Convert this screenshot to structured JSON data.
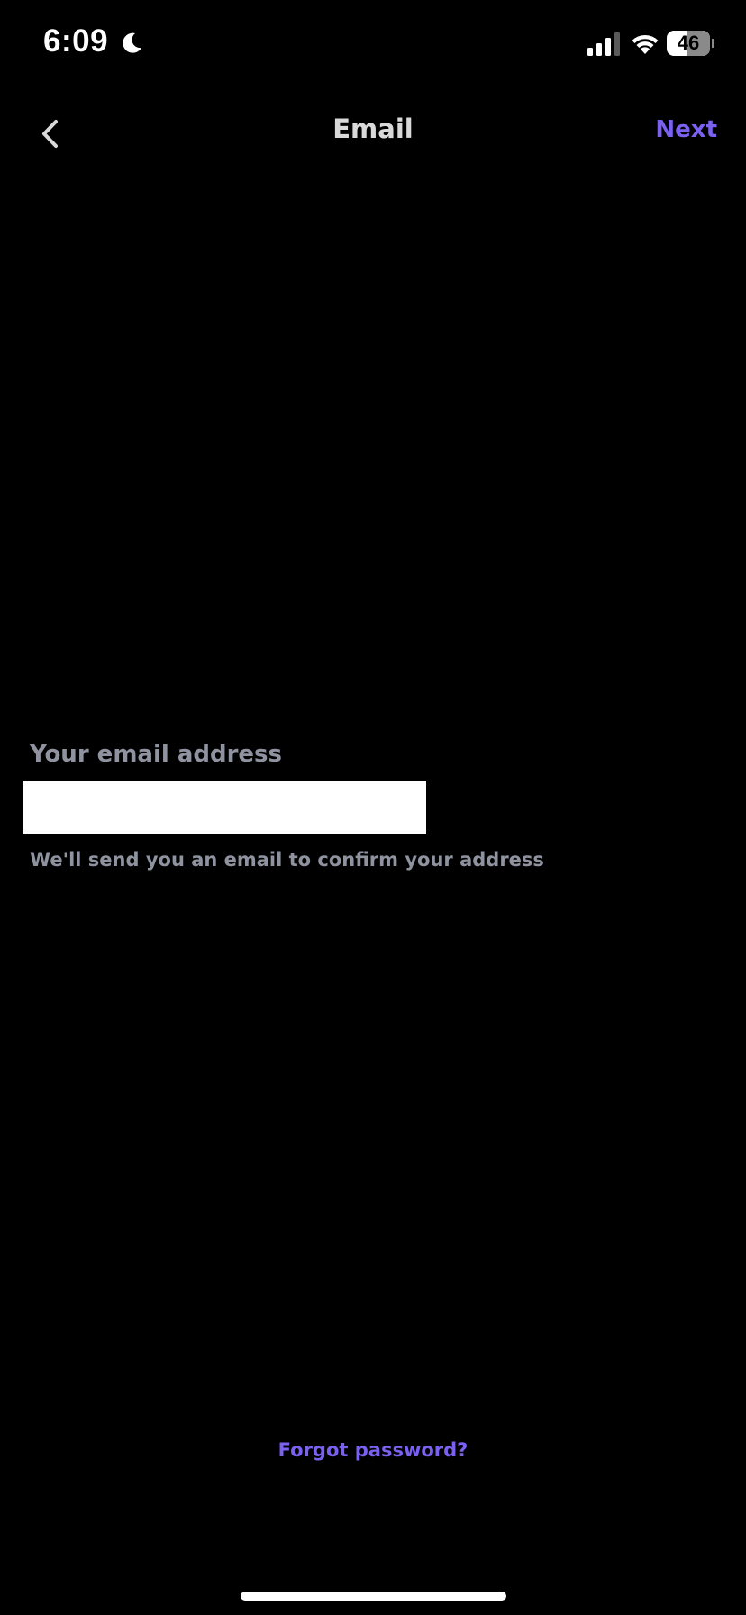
{
  "status_bar": {
    "time": "6:09",
    "battery_percent": "46",
    "battery_level": 0.46,
    "icons": [
      "moon-icon",
      "signal-icon",
      "wifi-icon",
      "battery-icon"
    ]
  },
  "nav": {
    "title": "Email",
    "back_icon": "chevron-left-icon",
    "next_label": "Next"
  },
  "form": {
    "email_label": "Your email address",
    "email_value": "",
    "helper_text": "We'll send you an email to confirm your address"
  },
  "footer": {
    "forgot_password_label": "Forgot password?"
  },
  "colors": {
    "background": "#000000",
    "accent": "#7b61f0",
    "muted_text": "#8e939f",
    "title_text": "#d9d9d9"
  }
}
